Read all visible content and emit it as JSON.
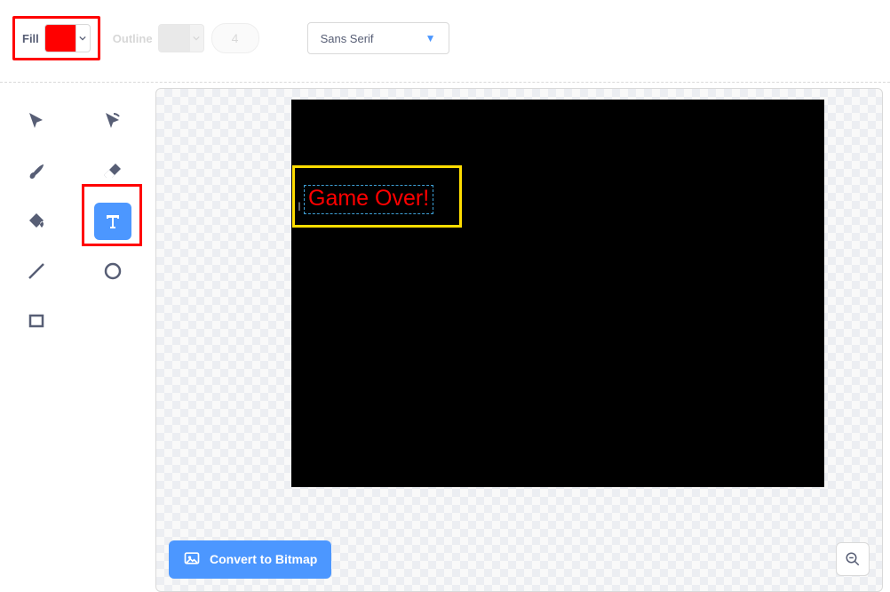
{
  "toolbar": {
    "fill_label": "Fill",
    "fill_color": "#ff0000",
    "outline_label": "Outline",
    "outline_thickness": "4",
    "font_name": "Sans Serif"
  },
  "tools": {
    "select": "select-tool",
    "reshape": "reshape-tool",
    "brush": "brush-tool",
    "eraser": "eraser-tool",
    "fill": "fill-bucket-tool",
    "text": "text-tool",
    "line": "line-tool",
    "circle": "circle-tool",
    "rect": "rectangle-tool",
    "selected": "text"
  },
  "canvas": {
    "text_value": "Game Over!",
    "text_color": "#ff0000"
  },
  "bottom": {
    "convert_label": "Convert to Bitmap"
  },
  "annotations": {
    "highlight_fill_picker": true,
    "highlight_text_tool": true,
    "highlight_text_box": true
  }
}
